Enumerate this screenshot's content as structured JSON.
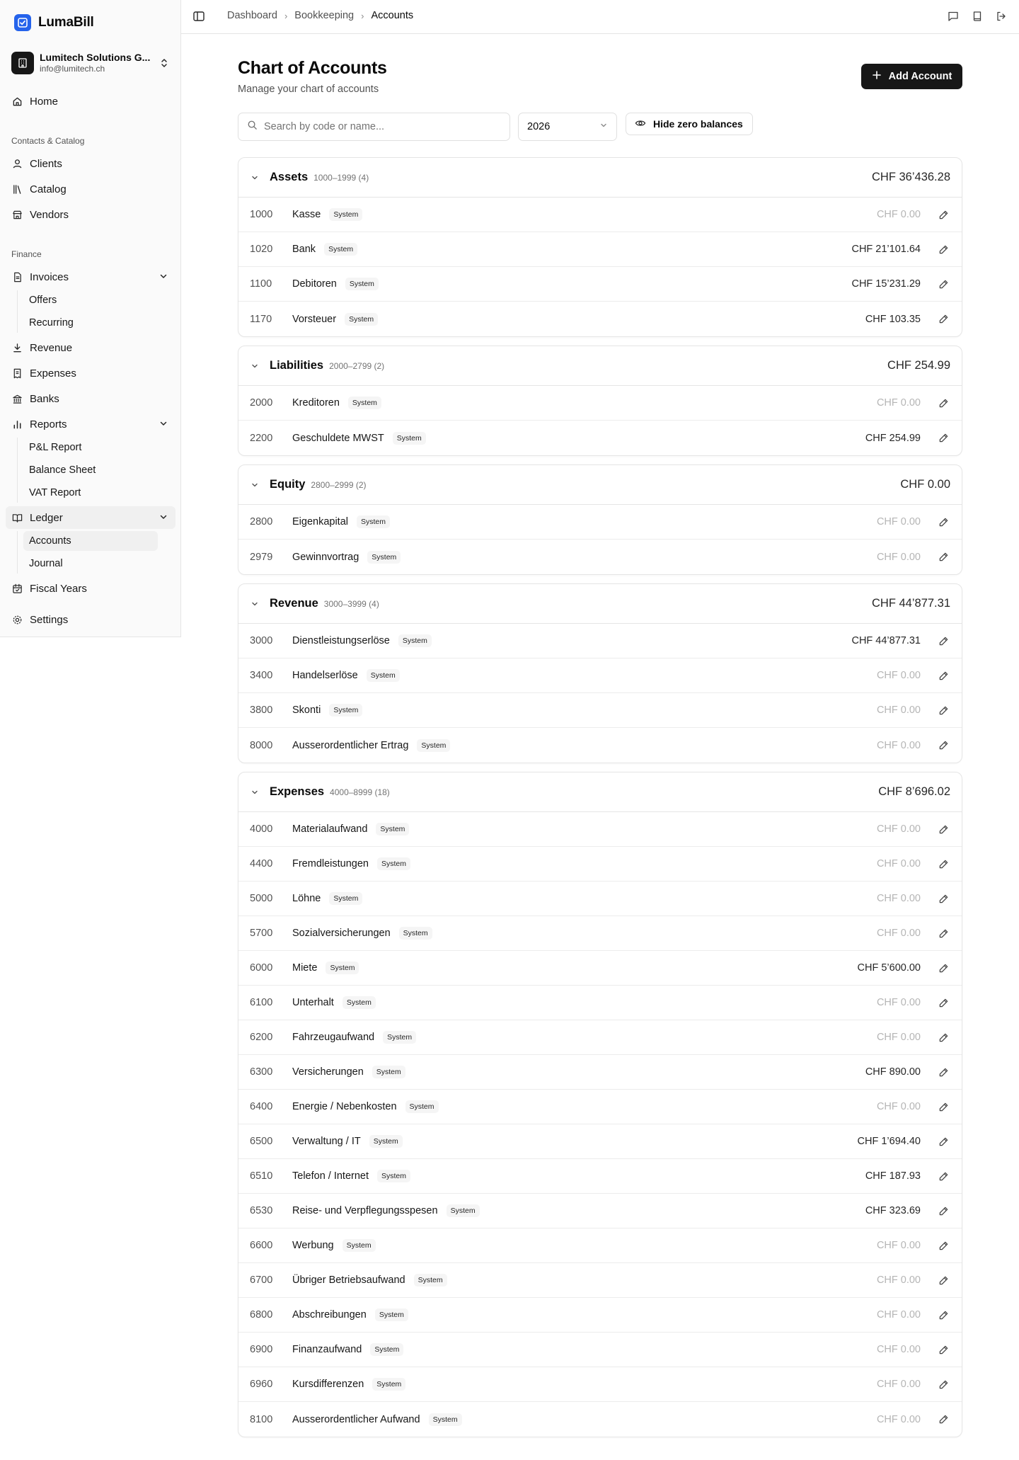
{
  "app": {
    "name": "LumaBill"
  },
  "org": {
    "name": "Lumitech Solutions G...",
    "email": "info@lumitech.ch"
  },
  "nav": {
    "home": "Home",
    "section_contacts": "Contacts & Catalog",
    "clients": "Clients",
    "catalog": "Catalog",
    "vendors": "Vendors",
    "section_finance": "Finance",
    "invoices": "Invoices",
    "offers": "Offers",
    "recurring": "Recurring",
    "revenue": "Revenue",
    "expenses": "Expenses",
    "banks": "Banks",
    "reports": "Reports",
    "pl_report": "P&L Report",
    "balance_sheet": "Balance Sheet",
    "vat_report": "VAT Report",
    "ledger": "Ledger",
    "accounts": "Accounts",
    "journal": "Journal",
    "fiscal_years": "Fiscal Years",
    "settings": "Settings"
  },
  "breadcrumb": [
    "Dashboard",
    "Bookkeeping",
    "Accounts"
  ],
  "page": {
    "title": "Chart of Accounts",
    "subtitle": "Manage your chart of accounts",
    "add_button": "Add Account",
    "search_placeholder": "Search by code or name...",
    "year": "2026",
    "hide_zero_label": "Hide zero balances"
  },
  "badge_label": "System",
  "groups": [
    {
      "name": "Assets",
      "range": "1000–1999 (4)",
      "total": "CHF 36’436.28",
      "accounts": [
        {
          "code": "1000",
          "name": "Kasse",
          "balance": "CHF 0.00",
          "zero": true
        },
        {
          "code": "1020",
          "name": "Bank",
          "balance": "CHF 21’101.64",
          "zero": false
        },
        {
          "code": "1100",
          "name": "Debitoren",
          "balance": "CHF 15’231.29",
          "zero": false
        },
        {
          "code": "1170",
          "name": "Vorsteuer",
          "balance": "CHF 103.35",
          "zero": false
        }
      ]
    },
    {
      "name": "Liabilities",
      "range": "2000–2799 (2)",
      "total": "CHF 254.99",
      "accounts": [
        {
          "code": "2000",
          "name": "Kreditoren",
          "balance": "CHF 0.00",
          "zero": true
        },
        {
          "code": "2200",
          "name": "Geschuldete MWST",
          "balance": "CHF 254.99",
          "zero": false
        }
      ]
    },
    {
      "name": "Equity",
      "range": "2800–2999 (2)",
      "total": "CHF 0.00",
      "accounts": [
        {
          "code": "2800",
          "name": "Eigenkapital",
          "balance": "CHF 0.00",
          "zero": true
        },
        {
          "code": "2979",
          "name": "Gewinnvortrag",
          "balance": "CHF 0.00",
          "zero": true
        }
      ]
    },
    {
      "name": "Revenue",
      "range": "3000–3999 (4)",
      "total": "CHF 44’877.31",
      "accounts": [
        {
          "code": "3000",
          "name": "Dienstleistungserlöse",
          "balance": "CHF 44’877.31",
          "zero": false
        },
        {
          "code": "3400",
          "name": "Handelserlöse",
          "balance": "CHF 0.00",
          "zero": true
        },
        {
          "code": "3800",
          "name": "Skonti",
          "balance": "CHF 0.00",
          "zero": true
        },
        {
          "code": "8000",
          "name": "Ausserordentlicher Ertrag",
          "balance": "CHF 0.00",
          "zero": true
        }
      ]
    },
    {
      "name": "Expenses",
      "range": "4000–8999 (18)",
      "total": "CHF 8’696.02",
      "accounts": [
        {
          "code": "4000",
          "name": "Materialaufwand",
          "balance": "CHF 0.00",
          "zero": true
        },
        {
          "code": "4400",
          "name": "Fremdleistungen",
          "balance": "CHF 0.00",
          "zero": true
        },
        {
          "code": "5000",
          "name": "Löhne",
          "balance": "CHF 0.00",
          "zero": true
        },
        {
          "code": "5700",
          "name": "Sozialversicherungen",
          "balance": "CHF 0.00",
          "zero": true
        },
        {
          "code": "6000",
          "name": "Miete",
          "balance": "CHF 5’600.00",
          "zero": false
        },
        {
          "code": "6100",
          "name": "Unterhalt",
          "balance": "CHF 0.00",
          "zero": true
        },
        {
          "code": "6200",
          "name": "Fahrzeugaufwand",
          "balance": "CHF 0.00",
          "zero": true
        },
        {
          "code": "6300",
          "name": "Versicherungen",
          "balance": "CHF 890.00",
          "zero": false
        },
        {
          "code": "6400",
          "name": "Energie / Nebenkosten",
          "balance": "CHF 0.00",
          "zero": true
        },
        {
          "code": "6500",
          "name": "Verwaltung / IT",
          "balance": "CHF 1’694.40",
          "zero": false
        },
        {
          "code": "6510",
          "name": "Telefon / Internet",
          "balance": "CHF 187.93",
          "zero": false
        },
        {
          "code": "6530",
          "name": "Reise- und Verpflegungsspesen",
          "balance": "CHF 323.69",
          "zero": false
        },
        {
          "code": "6600",
          "name": "Werbung",
          "balance": "CHF 0.00",
          "zero": true
        },
        {
          "code": "6700",
          "name": "Übriger Betriebsaufwand",
          "balance": "CHF 0.00",
          "zero": true
        },
        {
          "code": "6800",
          "name": "Abschreibungen",
          "balance": "CHF 0.00",
          "zero": true
        },
        {
          "code": "6900",
          "name": "Finanzaufwand",
          "balance": "CHF 0.00",
          "zero": true
        },
        {
          "code": "6960",
          "name": "Kursdifferenzen",
          "balance": "CHF 0.00",
          "zero": true
        },
        {
          "code": "8100",
          "name": "Ausserordentlicher Aufwand",
          "balance": "CHF 0.00",
          "zero": true
        }
      ]
    }
  ]
}
